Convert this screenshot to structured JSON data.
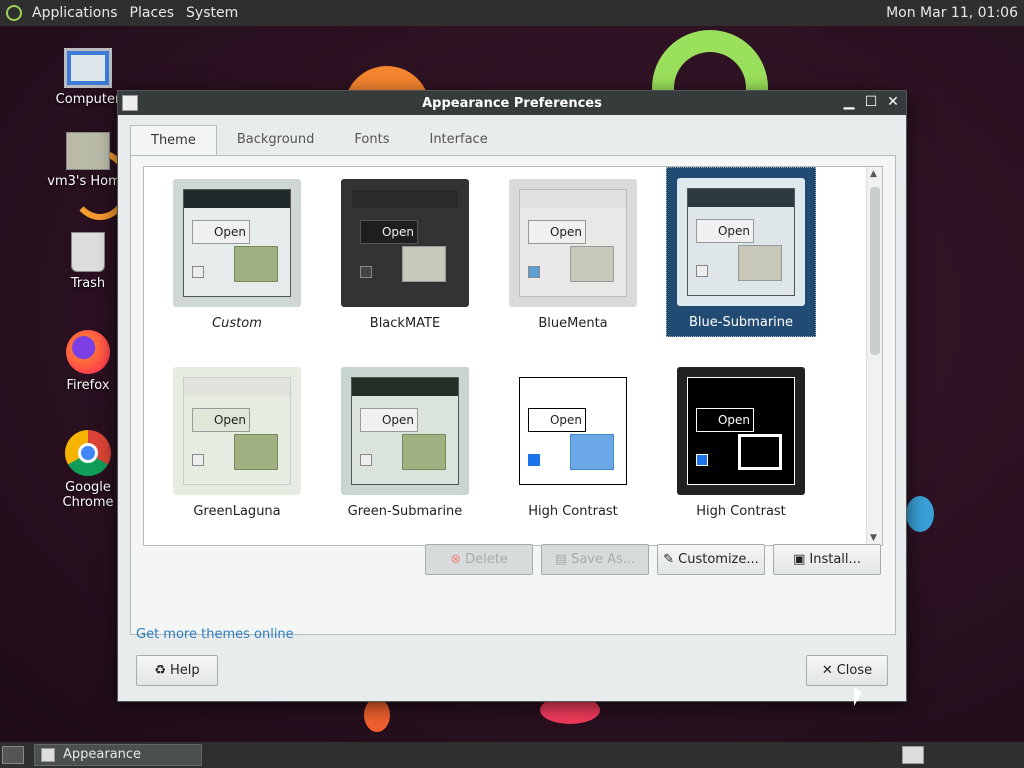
{
  "top_panel": {
    "menus": [
      "Applications",
      "Places",
      "System"
    ],
    "clock": "Mon Mar 11, 01:06"
  },
  "desktop_icons": [
    {
      "label": "Computer",
      "icon": "computer-icon"
    },
    {
      "label": "vm3's Home",
      "icon": "home-folder-icon"
    },
    {
      "label": "Trash",
      "icon": "trash-icon"
    },
    {
      "label": "Firefox",
      "icon": "firefox-icon"
    },
    {
      "label": "Google Chrome",
      "icon": "chrome-icon"
    }
  ],
  "window": {
    "title": "Appearance Preferences",
    "tabs": [
      "Theme",
      "Background",
      "Fonts",
      "Interface"
    ],
    "active_tab": "Theme",
    "themes": [
      {
        "label": "Custom",
        "selected": false
      },
      {
        "label": "BlackMATE",
        "selected": false
      },
      {
        "label": "BlueMenta",
        "selected": false
      },
      {
        "label": "Blue-Submarine",
        "selected": true
      },
      {
        "label": "GreenLaguna",
        "selected": false
      },
      {
        "label": "Green-Submarine",
        "selected": false
      },
      {
        "label": "High Contrast",
        "selected": false
      },
      {
        "label": "High Contrast",
        "selected": false
      }
    ],
    "thumb_text": "Open",
    "buttons": {
      "delete": "Delete",
      "save_as": "Save As...",
      "customize": "Customize...",
      "install": "Install..."
    },
    "link": "Get more themes online",
    "help": "Help",
    "close": "Close"
  },
  "taskbar": {
    "task": "Appearance Prefere..."
  },
  "colors": {
    "selection": "#224b74",
    "link": "#2e7dbf",
    "panel": "#2f2f2f"
  }
}
